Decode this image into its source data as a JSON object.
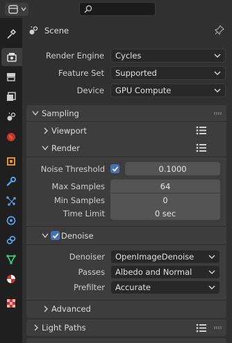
{
  "header": {
    "editor_icon": "properties-editor-icon",
    "search_icon": "search-icon",
    "search_placeholder": ""
  },
  "context": {
    "icon": "scene-icon",
    "title": "Scene",
    "pin_icon": "pin-icon"
  },
  "tabs": [
    {
      "name": "tool",
      "icon": "tool-icon",
      "active": false
    },
    {
      "name": "render",
      "icon": "render-icon",
      "active": true
    },
    {
      "name": "output",
      "icon": "output-icon",
      "active": false
    },
    {
      "name": "view-layer",
      "icon": "view-layer-icon",
      "active": false
    },
    {
      "name": "scene",
      "icon": "scene-icon",
      "active": false
    },
    {
      "name": "world",
      "icon": "world-icon",
      "active": false
    },
    {
      "name": "object",
      "icon": "object-icon",
      "active": false
    },
    {
      "name": "modifiers",
      "icon": "wrench-icon",
      "active": false
    },
    {
      "name": "particles",
      "icon": "particles-icon",
      "active": false
    },
    {
      "name": "physics",
      "icon": "physics-icon",
      "active": false
    },
    {
      "name": "constraints",
      "icon": "constraints-icon",
      "active": false
    },
    {
      "name": "data",
      "icon": "vertex-data-icon",
      "active": false
    },
    {
      "name": "material",
      "icon": "material-icon",
      "active": false
    },
    {
      "name": "texture",
      "icon": "texture-icon",
      "active": false
    }
  ],
  "render_engine": {
    "label": "Render Engine",
    "value": "Cycles"
  },
  "feature_set": {
    "label": "Feature Set",
    "value": "Supported"
  },
  "device": {
    "label": "Device",
    "value": "GPU Compute"
  },
  "sampling": {
    "title": "Sampling",
    "viewport": {
      "title": "Viewport"
    },
    "render": {
      "title": "Render",
      "noise_threshold_label": "Noise Threshold",
      "noise_threshold_enabled": true,
      "noise_threshold_value": "0.1000",
      "max_samples_label": "Max Samples",
      "max_samples_value": "64",
      "min_samples_label": "Min Samples",
      "min_samples_value": "0",
      "time_limit_label": "Time Limit",
      "time_limit_value": "0 sec"
    },
    "denoise": {
      "title": "Denoise",
      "enabled": true,
      "denoiser_label": "Denoiser",
      "denoiser_value": "OpenImageDenoise",
      "passes_label": "Passes",
      "passes_value": "Albedo and Normal",
      "prefilter_label": "Prefilter",
      "prefilter_value": "Accurate"
    },
    "advanced": {
      "title": "Advanced"
    }
  },
  "light_paths": {
    "title": "Light Paths"
  },
  "colors": {
    "accent": "#4772b3",
    "panel": "#303030",
    "subpanel": "#3d3d3d"
  }
}
